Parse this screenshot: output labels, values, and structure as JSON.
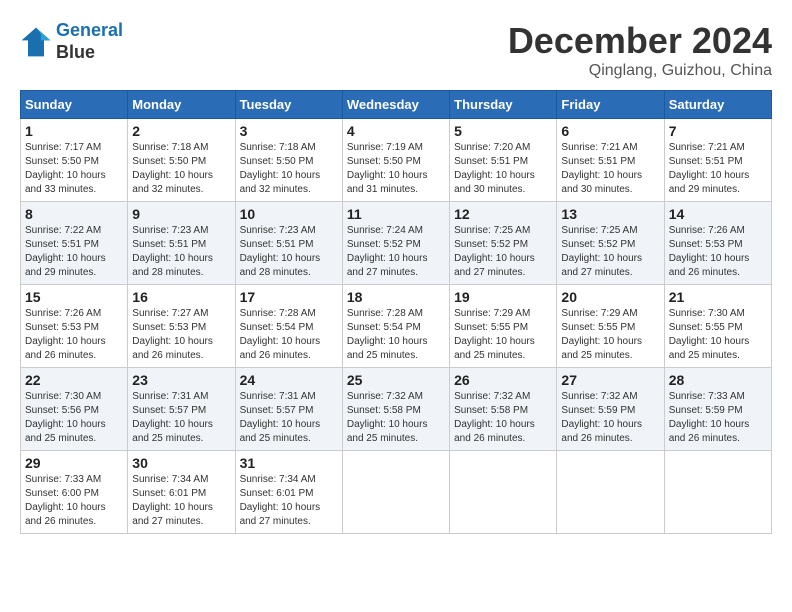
{
  "header": {
    "logo_line1": "General",
    "logo_line2": "Blue",
    "month_title": "December 2024",
    "location": "Qinglang, Guizhou, China"
  },
  "weekdays": [
    "Sunday",
    "Monday",
    "Tuesday",
    "Wednesday",
    "Thursday",
    "Friday",
    "Saturday"
  ],
  "weeks": [
    [
      {
        "day": "1",
        "info": "Sunrise: 7:17 AM\nSunset: 5:50 PM\nDaylight: 10 hours\nand 33 minutes."
      },
      {
        "day": "2",
        "info": "Sunrise: 7:18 AM\nSunset: 5:50 PM\nDaylight: 10 hours\nand 32 minutes."
      },
      {
        "day": "3",
        "info": "Sunrise: 7:18 AM\nSunset: 5:50 PM\nDaylight: 10 hours\nand 32 minutes."
      },
      {
        "day": "4",
        "info": "Sunrise: 7:19 AM\nSunset: 5:50 PM\nDaylight: 10 hours\nand 31 minutes."
      },
      {
        "day": "5",
        "info": "Sunrise: 7:20 AM\nSunset: 5:51 PM\nDaylight: 10 hours\nand 30 minutes."
      },
      {
        "day": "6",
        "info": "Sunrise: 7:21 AM\nSunset: 5:51 PM\nDaylight: 10 hours\nand 30 minutes."
      },
      {
        "day": "7",
        "info": "Sunrise: 7:21 AM\nSunset: 5:51 PM\nDaylight: 10 hours\nand 29 minutes."
      }
    ],
    [
      {
        "day": "8",
        "info": "Sunrise: 7:22 AM\nSunset: 5:51 PM\nDaylight: 10 hours\nand 29 minutes."
      },
      {
        "day": "9",
        "info": "Sunrise: 7:23 AM\nSunset: 5:51 PM\nDaylight: 10 hours\nand 28 minutes."
      },
      {
        "day": "10",
        "info": "Sunrise: 7:23 AM\nSunset: 5:51 PM\nDaylight: 10 hours\nand 28 minutes."
      },
      {
        "day": "11",
        "info": "Sunrise: 7:24 AM\nSunset: 5:52 PM\nDaylight: 10 hours\nand 27 minutes."
      },
      {
        "day": "12",
        "info": "Sunrise: 7:25 AM\nSunset: 5:52 PM\nDaylight: 10 hours\nand 27 minutes."
      },
      {
        "day": "13",
        "info": "Sunrise: 7:25 AM\nSunset: 5:52 PM\nDaylight: 10 hours\nand 27 minutes."
      },
      {
        "day": "14",
        "info": "Sunrise: 7:26 AM\nSunset: 5:53 PM\nDaylight: 10 hours\nand 26 minutes."
      }
    ],
    [
      {
        "day": "15",
        "info": "Sunrise: 7:26 AM\nSunset: 5:53 PM\nDaylight: 10 hours\nand 26 minutes."
      },
      {
        "day": "16",
        "info": "Sunrise: 7:27 AM\nSunset: 5:53 PM\nDaylight: 10 hours\nand 26 minutes."
      },
      {
        "day": "17",
        "info": "Sunrise: 7:28 AM\nSunset: 5:54 PM\nDaylight: 10 hours\nand 26 minutes."
      },
      {
        "day": "18",
        "info": "Sunrise: 7:28 AM\nSunset: 5:54 PM\nDaylight: 10 hours\nand 25 minutes."
      },
      {
        "day": "19",
        "info": "Sunrise: 7:29 AM\nSunset: 5:55 PM\nDaylight: 10 hours\nand 25 minutes."
      },
      {
        "day": "20",
        "info": "Sunrise: 7:29 AM\nSunset: 5:55 PM\nDaylight: 10 hours\nand 25 minutes."
      },
      {
        "day": "21",
        "info": "Sunrise: 7:30 AM\nSunset: 5:55 PM\nDaylight: 10 hours\nand 25 minutes."
      }
    ],
    [
      {
        "day": "22",
        "info": "Sunrise: 7:30 AM\nSunset: 5:56 PM\nDaylight: 10 hours\nand 25 minutes."
      },
      {
        "day": "23",
        "info": "Sunrise: 7:31 AM\nSunset: 5:57 PM\nDaylight: 10 hours\nand 25 minutes."
      },
      {
        "day": "24",
        "info": "Sunrise: 7:31 AM\nSunset: 5:57 PM\nDaylight: 10 hours\nand 25 minutes."
      },
      {
        "day": "25",
        "info": "Sunrise: 7:32 AM\nSunset: 5:58 PM\nDaylight: 10 hours\nand 25 minutes."
      },
      {
        "day": "26",
        "info": "Sunrise: 7:32 AM\nSunset: 5:58 PM\nDaylight: 10 hours\nand 26 minutes."
      },
      {
        "day": "27",
        "info": "Sunrise: 7:32 AM\nSunset: 5:59 PM\nDaylight: 10 hours\nand 26 minutes."
      },
      {
        "day": "28",
        "info": "Sunrise: 7:33 AM\nSunset: 5:59 PM\nDaylight: 10 hours\nand 26 minutes."
      }
    ],
    [
      {
        "day": "29",
        "info": "Sunrise: 7:33 AM\nSunset: 6:00 PM\nDaylight: 10 hours\nand 26 minutes."
      },
      {
        "day": "30",
        "info": "Sunrise: 7:34 AM\nSunset: 6:01 PM\nDaylight: 10 hours\nand 27 minutes."
      },
      {
        "day": "31",
        "info": "Sunrise: 7:34 AM\nSunset: 6:01 PM\nDaylight: 10 hours\nand 27 minutes."
      },
      null,
      null,
      null,
      null
    ]
  ]
}
